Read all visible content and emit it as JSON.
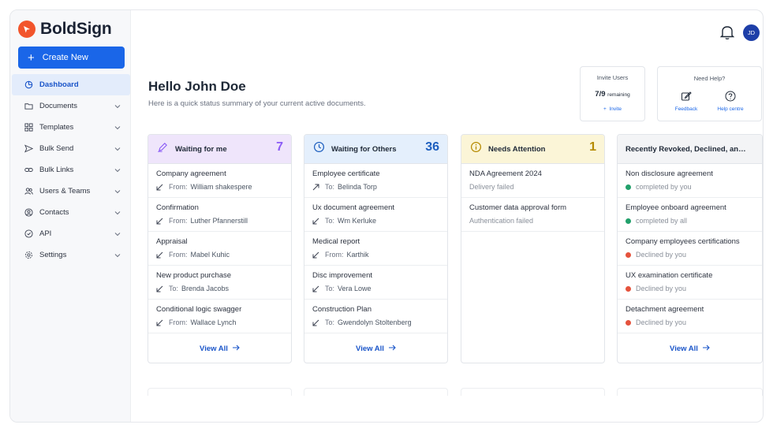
{
  "brand": {
    "name": "BoldSign",
    "color": "#f2552c"
  },
  "sidebar": {
    "create_label": "Create New",
    "items": [
      {
        "label": "Dashboard",
        "icon": "dashboard-icon",
        "active": true
      },
      {
        "label": "Documents",
        "icon": "folder-icon"
      },
      {
        "label": "Templates",
        "icon": "templates-icon"
      },
      {
        "label": "Bulk Send",
        "icon": "send-icon"
      },
      {
        "label": "Bulk Links",
        "icon": "link-icon"
      },
      {
        "label": "Users & Teams",
        "icon": "users-icon"
      },
      {
        "label": "Contacts",
        "icon": "contact-icon"
      },
      {
        "label": "API",
        "icon": "api-icon"
      },
      {
        "label": "Settings",
        "icon": "gear-icon"
      }
    ]
  },
  "header": {
    "avatar_initials": "JD"
  },
  "greeting": {
    "title": "Hello John Doe",
    "subtitle": "Here is a quick status summary of your current active documents."
  },
  "invite": {
    "title": "Invite Users",
    "count": "7/9",
    "remaining": "remaining",
    "link": "Invite"
  },
  "help": {
    "title": "Need Help?",
    "feedback": "Feedback",
    "centre": "Help centre"
  },
  "columns": [
    {
      "title": "Waiting for me",
      "count": "7",
      "accent": "#8b5cf6",
      "head_bg": "#efe5fb",
      "rows": [
        {
          "title": "Company agreement",
          "dir": "From:",
          "who": "William shakespere"
        },
        {
          "title": "Confirmation",
          "dir": "From:",
          "who": "Luther Pfannerstill"
        },
        {
          "title": "Appraisal",
          "dir": "From:",
          "who": "Mabel Kuhic"
        },
        {
          "title": "New product purchase",
          "dir": "To:",
          "who": "Brenda Jacobs"
        },
        {
          "title": "Conditional logic swagger",
          "dir": "From:",
          "who": "Wallace Lynch"
        }
      ],
      "view_all": "View All"
    },
    {
      "title": "Waiting for Others",
      "count": "36",
      "accent": "#1e5fbf",
      "head_bg": "#e4effc",
      "rows": [
        {
          "title": "Employee certificate",
          "dir": "To:",
          "who": "Belinda Torp"
        },
        {
          "title": "Ux document agreement",
          "dir": "To:",
          "who": "Wm Kerluke"
        },
        {
          "title": "Medical report",
          "dir": "From:",
          "who": "Karthik"
        },
        {
          "title": "Disc improvement",
          "dir": "To:",
          "who": "Vera Lowe"
        },
        {
          "title": "Construction Plan",
          "dir": "To:",
          "who": "Gwendolyn Stoltenberg"
        }
      ],
      "view_all": "View All"
    },
    {
      "title": "Needs Attention",
      "count": "1",
      "accent": "#b58a00",
      "head_bg": "#fbf5d7",
      "rows": [
        {
          "title": "NDA Agreement 2024",
          "status": "Delivery failed"
        },
        {
          "title": "Customer data approval form",
          "status": "Authentication failed"
        }
      ]
    },
    {
      "title": "Recently Revoked, Declined, and Completed",
      "head_bg": "#f3f4f6",
      "rows": [
        {
          "title": "Non disclosure agreement",
          "status": "completed by you",
          "state": "ok"
        },
        {
          "title": "Employee onboard agreement",
          "status": "completed by all",
          "state": "ok"
        },
        {
          "title": "Company employees certifications",
          "status": "Declined by you",
          "state": "declined"
        },
        {
          "title": "UX examination certificate",
          "status": "Declined by you",
          "state": "declined"
        },
        {
          "title": "Detachment agreement",
          "status": "Declined by you",
          "state": "declined"
        }
      ],
      "view_all": "View All"
    }
  ],
  "colors": {
    "primary": "#1a66e8",
    "ok": "#22a06b",
    "declined": "#e5533d"
  }
}
